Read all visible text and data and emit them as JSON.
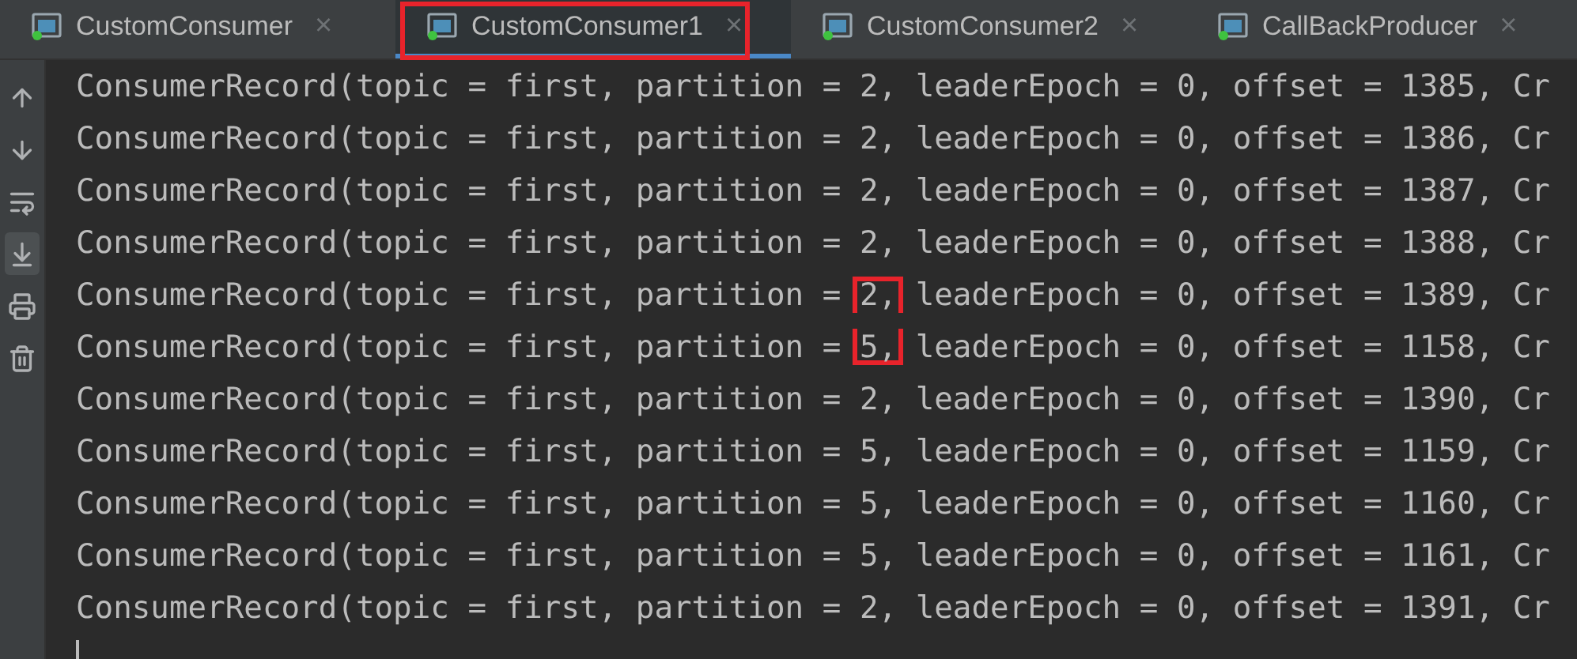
{
  "tabs": [
    {
      "label": "CustomConsumer",
      "close": "×",
      "selected": false,
      "marked": false
    },
    {
      "label": "CustomConsumer1",
      "close": "×",
      "selected": true,
      "marked": true
    },
    {
      "label": "CustomConsumer2",
      "close": "×",
      "selected": false,
      "marked": false
    },
    {
      "label": "CallBackProducer",
      "close": "×",
      "selected": false,
      "marked": false
    }
  ],
  "toolbar": [
    {
      "kind": "up",
      "selected": false
    },
    {
      "kind": "down",
      "selected": false
    },
    {
      "kind": "wrap",
      "selected": false
    },
    {
      "kind": "scroll-end",
      "selected": true
    },
    {
      "kind": "print",
      "selected": false
    },
    {
      "kind": "trash",
      "selected": false
    }
  ],
  "console": [
    {
      "before": "ConsumerRecord(topic = first, partition = ",
      "partition": "2,",
      "after": " leaderEpoch = 0, offset = 1385, Cr",
      "marked": false
    },
    {
      "before": "ConsumerRecord(topic = first, partition = ",
      "partition": "2,",
      "after": " leaderEpoch = 0, offset = 1386, Cr",
      "marked": false
    },
    {
      "before": "ConsumerRecord(topic = first, partition = ",
      "partition": "2,",
      "after": " leaderEpoch = 0, offset = 1387, Cr",
      "marked": false
    },
    {
      "before": "ConsumerRecord(topic = first, partition = ",
      "partition": "2,",
      "after": " leaderEpoch = 0, offset = 1388, Cr",
      "marked": false
    },
    {
      "before": "ConsumerRecord(topic = first, partition = ",
      "partition": "2,",
      "after": " leaderEpoch = 0, offset = 1389, Cr",
      "marked": true
    },
    {
      "before": "ConsumerRecord(topic = first, partition = ",
      "partition": "5,",
      "after": " leaderEpoch = 0, offset = 1158, Cr",
      "marked": true
    },
    {
      "before": "ConsumerRecord(topic = first, partition = ",
      "partition": "2,",
      "after": " leaderEpoch = 0, offset = 1390, Cr",
      "marked": false
    },
    {
      "before": "ConsumerRecord(topic = first, partition = ",
      "partition": "5,",
      "after": " leaderEpoch = 0, offset = 1159, Cr",
      "marked": false
    },
    {
      "before": "ConsumerRecord(topic = first, partition = ",
      "partition": "5,",
      "after": " leaderEpoch = 0, offset = 1160, Cr",
      "marked": false
    },
    {
      "before": "ConsumerRecord(topic = first, partition = ",
      "partition": "5,",
      "after": " leaderEpoch = 0, offset = 1161, Cr",
      "marked": false
    },
    {
      "before": "ConsumerRecord(topic = first, partition = ",
      "partition": "2,",
      "after": " leaderEpoch = 0, offset = 1391, Cr",
      "marked": false
    }
  ]
}
